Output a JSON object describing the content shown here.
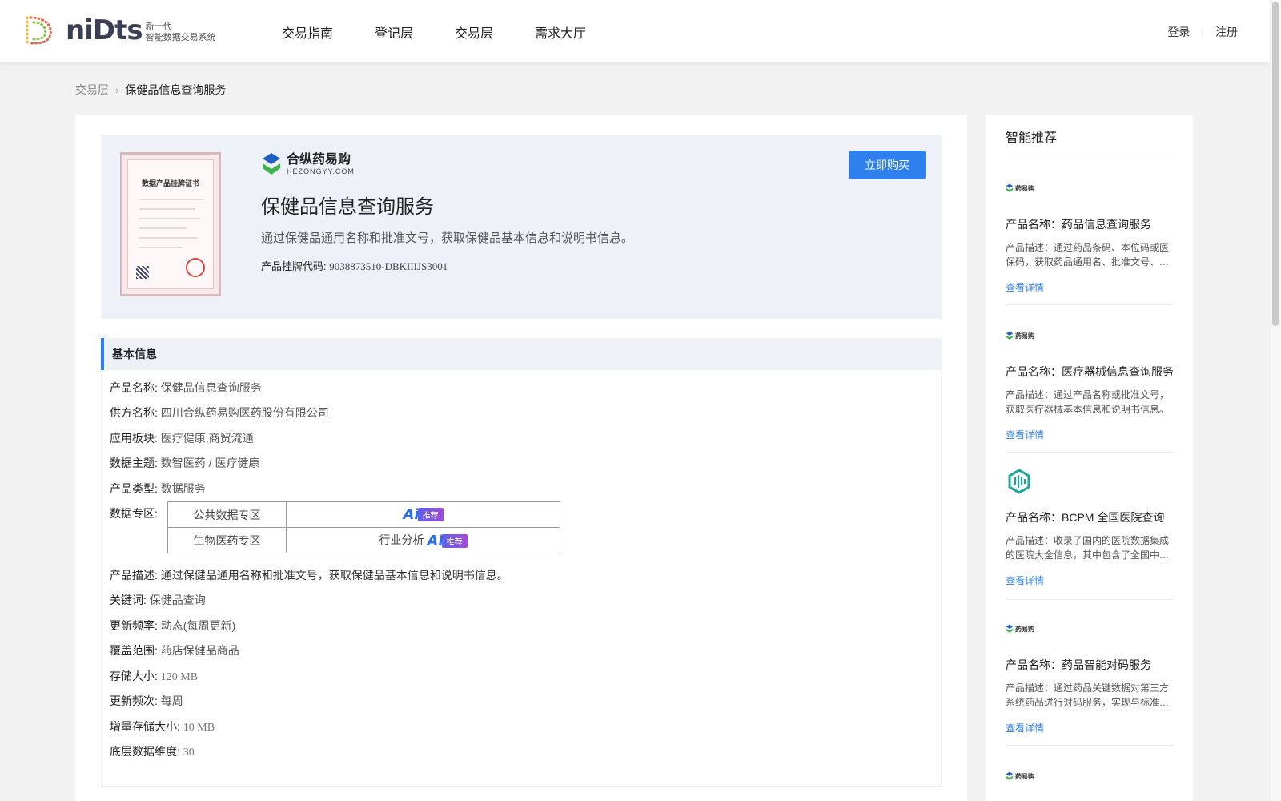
{
  "header": {
    "logo_word": "niDts",
    "logo_sub_line1": "新一代",
    "logo_sub_line2": "智能数据交易系统",
    "nav": [
      "交易指南",
      "登记层",
      "交易层",
      "需求大厅"
    ],
    "login": "登录",
    "register": "注册"
  },
  "breadcrumb": {
    "parent": "交易层",
    "current": "保健品信息查询服务"
  },
  "hero": {
    "certificate_title": "数据产品挂牌证书",
    "brand_cn": "合纵药易购",
    "brand_en": "HEZONGYY.COM",
    "title": "保健品信息查询服务",
    "description": "通过保健品通用名称和批准文号，获取保健品基本信息和说明书信息。",
    "code_label": "产品挂牌代码:",
    "code_value": "9038873510-DBKIIIJS3001",
    "buy_label": "立即购买"
  },
  "basic_info": {
    "section_title": "基本信息",
    "product_name_label": "产品名称:",
    "product_name": "保健品信息查询服务",
    "supplier_label": "供方名称:",
    "supplier": "四川合纵药易购医药股份有限公司",
    "sector_label": "应用板块:",
    "sector": "医疗健康,商贸流通",
    "topic_label": "数据主题:",
    "topic": "数智医药 / 医疗健康",
    "type_label": "产品类型:",
    "type": "数据服务",
    "zone_label": "数据专区:",
    "zones": [
      {
        "name": "公共数据专区",
        "value": "",
        "tag": "推荐"
      },
      {
        "name": "生物医药专区",
        "value": "行业分析",
        "tag": "推荐"
      }
    ],
    "ai_letter": "Ai",
    "desc_label": "产品描述:",
    "desc": "通过保健品通用名称和批准文号，获取保健品基本信息和说明书信息。",
    "keywords_label": "关键词:",
    "keywords": "保健品查询",
    "update_freq_label": "更新频率:",
    "update_freq": "动态(每周更新)",
    "coverage_label": "覆盖范围:",
    "coverage": "药店保健品商品",
    "storage_label": "存储大小:",
    "storage": "120 MB",
    "update_times_label": "更新频次:",
    "update_times": "每周",
    "incremental_label": "增量存储大小:",
    "incremental": "10 MB",
    "dimension_label": "底层数据维度:",
    "dimension": "30"
  },
  "recommend": {
    "title": "智能推荐",
    "mini_brand": "药易购",
    "items": [
      {
        "name": "产品名称：药品信息查询服务",
        "desc": "产品描述：通过药品条码、本位码或医保码，获取药品通用名、批准文号、…",
        "link": "查看详情",
        "logo": "brand"
      },
      {
        "name": "产品名称：医疗器械信息查询服务",
        "desc": "产品描述：通过产品名称或批准文号，获取医疗器械基本信息和说明书信息。",
        "link": "查看详情",
        "logo": "brand"
      },
      {
        "name": "产品名称：BCPM 全国医院查询",
        "desc": "产品描述：收录了国内的医院数据集成的医院大全信息，其中包含了全国中…",
        "link": "查看详情",
        "logo": "bcpm"
      },
      {
        "name": "产品名称：药品智能对码服务",
        "desc": "产品描述：通过药品关键数据对第三方系统药品进行对码服务，实现与标准…",
        "link": "查看详情",
        "logo": "brand"
      }
    ]
  },
  "colors": {
    "accent": "#2f80ed",
    "page_bg": "#f2f2f2",
    "hero_bg": "#eef2f8"
  }
}
